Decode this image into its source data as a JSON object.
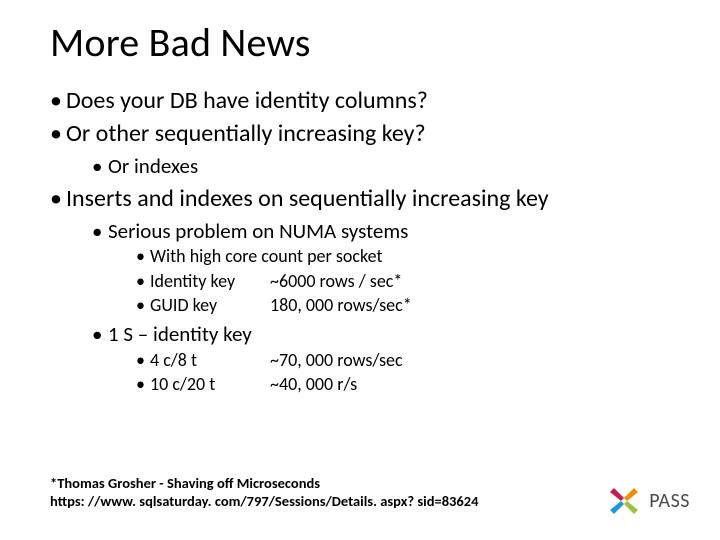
{
  "title": "More Bad News",
  "bullets_top": [
    "Does your DB have identity columns?",
    "Or other sequentially increasing key?"
  ],
  "sub_top": "Or indexes",
  "bullet_main": "Inserts and indexes on sequentially increasing key",
  "sub_main_1": "Serious problem on NUMA systems",
  "sub_main_1_items": {
    "a": "With high core count per socket",
    "b_key": "Identity key",
    "b_val": "~6000 rows / sec*",
    "c_key": "GUID key",
    "c_val": "180, 000 rows/sec*"
  },
  "sub_main_2": "1 S – identity key",
  "sub_main_2_items": {
    "a_key": "4 c/8 t",
    "a_val": "~70, 000 rows/sec",
    "b_key": "10 c/20 t",
    "b_val": "~40, 000 r/s"
  },
  "footnote": {
    "line1": "*Thomas Grosher - Shaving off Microseconds",
    "line2": "https: //www. sqlsaturday. com/797/Sessions/Details. aspx? sid=83624"
  },
  "logo_text": "PASS"
}
